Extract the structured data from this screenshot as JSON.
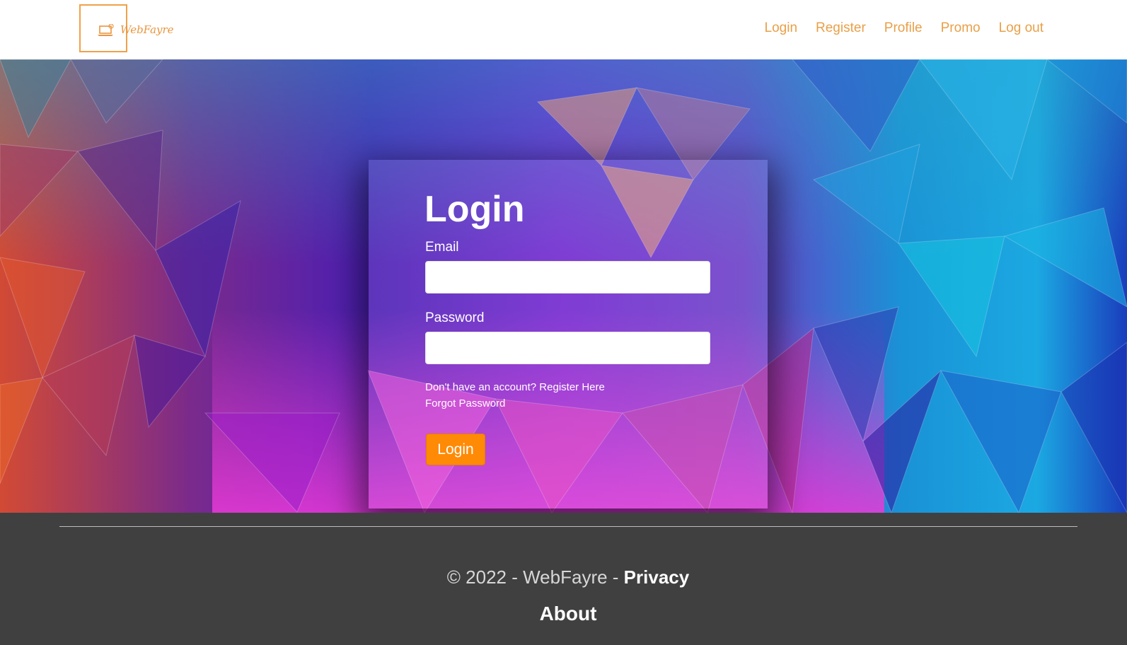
{
  "navbar": {
    "brand": "WebFayre",
    "links": [
      "Login",
      "Register",
      "Profile",
      "Promo",
      "Log out"
    ]
  },
  "login_form": {
    "title": "Login",
    "email_label": "Email",
    "email_value": "",
    "password_label": "Password",
    "password_value": "",
    "register_text": "Don't have an account? Register Here",
    "forgot_text": "Forgot Password",
    "submit_label": "Login"
  },
  "footer": {
    "copyright": "© 2022 - WebFayre - ",
    "privacy": "Privacy",
    "about": "About"
  },
  "colors": {
    "accent": "#e8a048",
    "button": "#ff8a05",
    "footer_bg": "#404040"
  },
  "icons": [
    "laptop-icon"
  ]
}
